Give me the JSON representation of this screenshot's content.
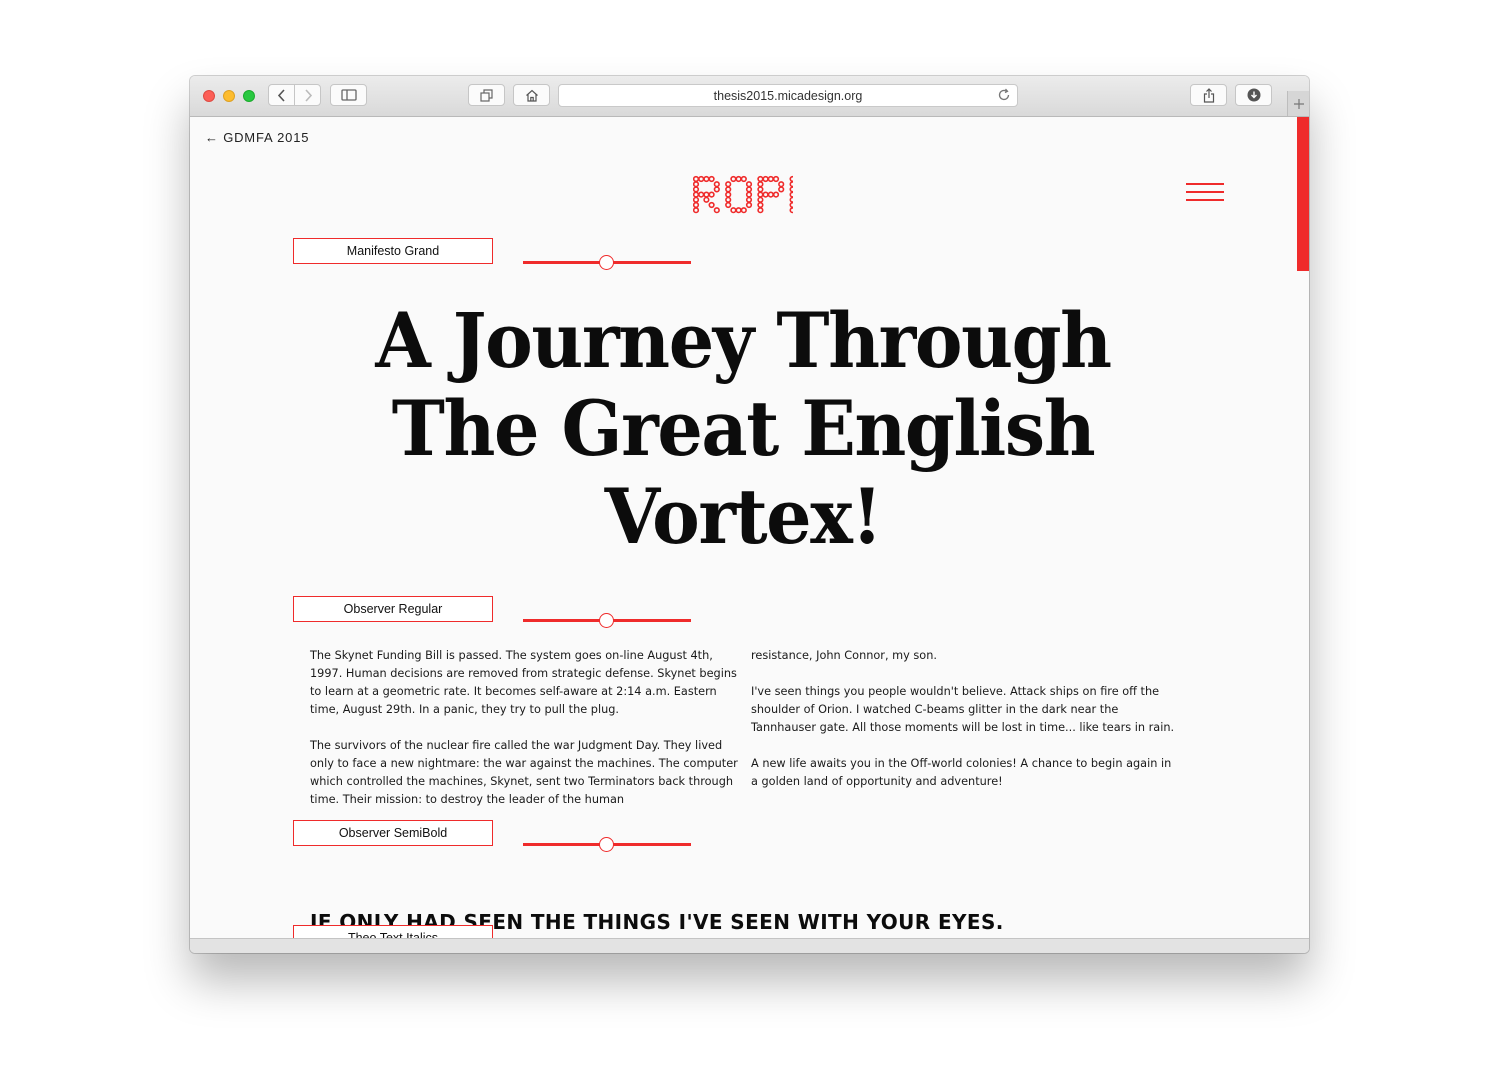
{
  "browser": {
    "url": "thesis2015.micadesign.org"
  },
  "page": {
    "back_link": "← GDMFA 2015",
    "logo_text": "ROPE",
    "accent_color": "#ef2b2b",
    "sections": [
      {
        "font_name": "Manifesto Grand",
        "slider_level": 0.5
      },
      {
        "font_name": "Observer Regular",
        "slider_level": 0.5
      },
      {
        "font_name": "Observer SemiBold",
        "slider_level": 0.5
      },
      {
        "font_name": "Theo Text Italics"
      }
    ],
    "headline_lines": [
      "A Journey Through",
      "The Great English",
      "Vortex!"
    ],
    "body_left": [
      "The Skynet Funding Bill is passed. The system goes on-line August 4th, 1997. Human decisions are removed from strategic defense. Skynet begins to learn at a geometric rate. It becomes self-aware at 2:14 a.m. Eastern time, August 29th. In a panic, they try to pull the plug.",
      "The survivors of the nuclear fire called the war Judgment Day. They lived only to face a new nightmare: the war against the machines. The computer which controlled the machines, Skynet, sent two Terminators back through time. Their mission: to destroy the leader of the human"
    ],
    "body_right": [
      "resistance, John Connor, my son.",
      "I've seen things you people wouldn't believe. Attack ships on fire off the shoulder of Orion. I watched C-beams glitter in the dark near the Tannhauser gate. All those moments will be lost in time... like tears in rain.",
      "A new life awaits you in the Off-world colonies! A chance to begin again in a golden land of opportunity and adventure!"
    ],
    "caps_line": "IF ONLY HAD SEEN THE THINGS I'VE SEEN WITH YOUR EYES."
  }
}
